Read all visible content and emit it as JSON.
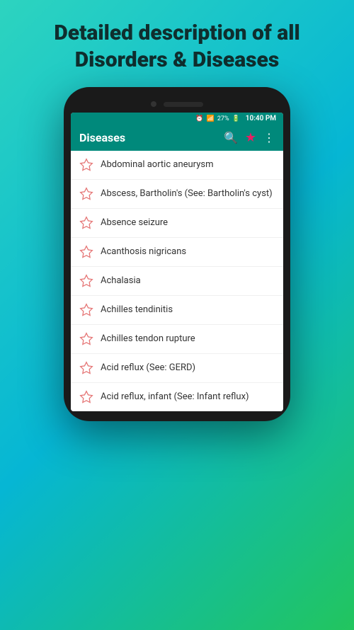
{
  "headline": {
    "line1": "Detailed description of all",
    "line2": "Disorders & Diseases"
  },
  "statusBar": {
    "battery": "27%",
    "time": "10:40 PM"
  },
  "toolbar": {
    "title": "Diseases"
  },
  "diseases": [
    {
      "id": 1,
      "name": "Abdominal aortic aneurysm"
    },
    {
      "id": 2,
      "name": "Abscess, Bartholin's (See:\nBartholin's cyst)"
    },
    {
      "id": 3,
      "name": "Absence seizure"
    },
    {
      "id": 4,
      "name": "Acanthosis nigricans"
    },
    {
      "id": 5,
      "name": "Achalasia"
    },
    {
      "id": 6,
      "name": "Achilles tendinitis"
    },
    {
      "id": 7,
      "name": "Achilles tendon rupture"
    },
    {
      "id": 8,
      "name": "Acid reflux (See: GERD)"
    },
    {
      "id": 9,
      "name": "Acid reflux, infant (See: Infant\nreflux)"
    }
  ]
}
